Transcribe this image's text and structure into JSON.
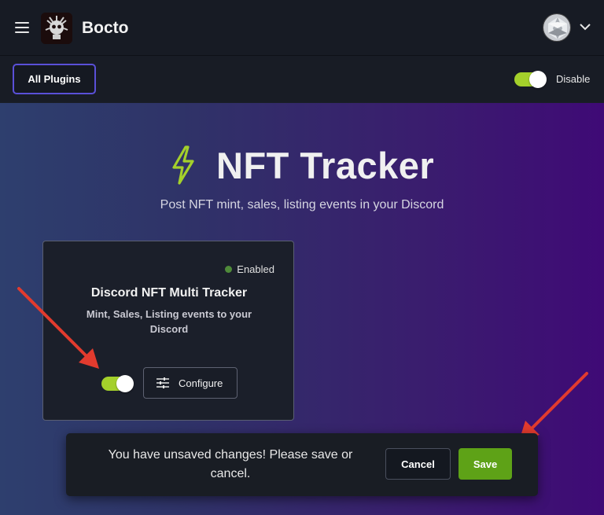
{
  "header": {
    "brand": "Bocto",
    "menu_icon": "hamburger-menu-icon",
    "logo_icon": "bot-logo-icon",
    "avatar_icon": "user-avatar",
    "dropdown_icon": "chevron-down-icon"
  },
  "subbar": {
    "all_plugins_label": "All Plugins",
    "plugin_toggle_on": true,
    "disable_label": "Disable"
  },
  "plugin": {
    "title": "NFT Tracker",
    "subtitle": "Post NFT mint, sales, listing events in your Discord",
    "icon": "lightning-bolt-icon"
  },
  "card": {
    "status": "Enabled",
    "status_color": "#4f8a3a",
    "title": "Discord NFT Multi Tracker",
    "description": "Mint, Sales, Listing events to your Discord",
    "toggle_on": true,
    "configure_label": "Configure",
    "configure_icon": "sliders-icon"
  },
  "unsaved_bar": {
    "message": "You have unsaved changes! Please save or cancel.",
    "cancel_label": "Cancel",
    "save_label": "Save"
  },
  "colors": {
    "accent_green": "#a4d02b",
    "save_green": "#5ea217",
    "border_purple": "#5a50d8",
    "annotation_arrow": "#e23b2e"
  }
}
